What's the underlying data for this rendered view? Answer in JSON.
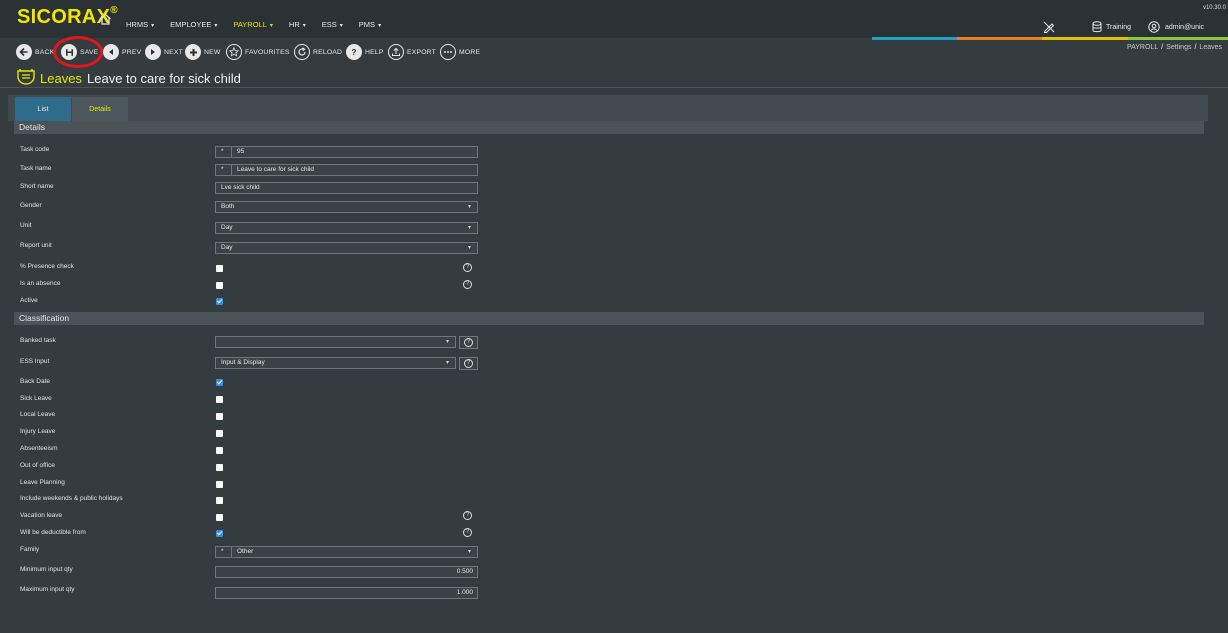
{
  "app": {
    "logo": "SICORAX",
    "logo_mark": "®",
    "version": "v10.30.0"
  },
  "menu": [
    {
      "label": "HRMS",
      "caret": "▾",
      "active": false
    },
    {
      "label": "EMPLOYEE",
      "caret": "▾",
      "active": false
    },
    {
      "label": "PAYROLL",
      "caret": "▾",
      "active": true
    },
    {
      "label": "HR",
      "caret": "▾",
      "active": false
    },
    {
      "label": "ESS",
      "caret": "▾",
      "active": false
    },
    {
      "label": "PMS",
      "caret": "▾",
      "active": false
    }
  ],
  "header_right": {
    "environment": "Training",
    "user": "admin@unic"
  },
  "accent_colors": [
    "#22a3c6",
    "#e67e22",
    "#e6c000",
    "#8cc63e"
  ],
  "toolbar": {
    "back": "BACK",
    "save": "SAVE",
    "prev": "PREV",
    "next": "NEXT",
    "new": "NEW",
    "favourites": "FAVOURITES",
    "reload": "RELOAD",
    "help": "HELP",
    "export": "EXPORT",
    "more": "MORE"
  },
  "breadcrumb": [
    "PAYROLL",
    "Settings",
    "Leaves"
  ],
  "breadcrumb_sep": "/",
  "page": {
    "module": "Leaves",
    "record": "Leave to care for sick child"
  },
  "tabs": {
    "list": "List",
    "details": "Details"
  },
  "details": {
    "header": "Details",
    "required_mark": "*",
    "task_code": {
      "label": "Task code",
      "value": "95"
    },
    "task_name": {
      "label": "Task name",
      "value": "Leave to care for sick child"
    },
    "short_name": {
      "label": "Short name",
      "value": "Lve sick child"
    },
    "gender": {
      "label": "Gender",
      "value": "Both"
    },
    "unit": {
      "label": "Unit",
      "value": "Day"
    },
    "report_unit": {
      "label": "Report unit",
      "value": "Day"
    },
    "presence_check": {
      "label": "% Presence check",
      "checked": false
    },
    "is_absence": {
      "label": "Is an absence",
      "checked": false
    },
    "active": {
      "label": "Active",
      "checked": true
    }
  },
  "classification": {
    "header": "Classification",
    "banked_task": {
      "label": "Banked task",
      "value": ""
    },
    "ess_input": {
      "label": "ESS Input",
      "value": "Input & Display"
    },
    "back_date": {
      "label": "Back Date",
      "checked": true
    },
    "sick_leave": {
      "label": "Sick Leave",
      "checked": false
    },
    "local_leave": {
      "label": "Local Leave",
      "checked": false
    },
    "injury_leave": {
      "label": "Injury Leave",
      "checked": false
    },
    "absenteeism": {
      "label": "Absenteeism",
      "checked": false
    },
    "out_of_office": {
      "label": "Out of office",
      "checked": false
    },
    "leave_planning": {
      "label": "Leave Planning",
      "checked": false
    },
    "include_weekends": {
      "label": "Include weekends & public holidays",
      "checked": false
    },
    "vacation_leave": {
      "label": "Vacation leave",
      "checked": false
    },
    "deductible": {
      "label": "Will be deductible from",
      "checked": true
    },
    "family": {
      "label": "Family",
      "value": "Other"
    },
    "min_qty": {
      "label": "Minimum input qty",
      "value": "0.500"
    },
    "max_qty": {
      "label": "Maximum input qty",
      "value": "1.000"
    }
  },
  "icons": {
    "dropdown": "▾",
    "help": "?"
  }
}
